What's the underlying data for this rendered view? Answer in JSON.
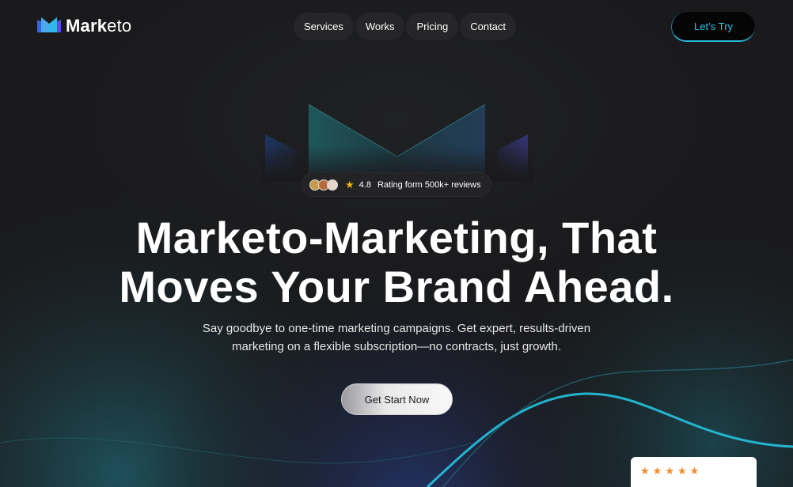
{
  "brand": {
    "name_bold": "Mark",
    "name_light": "eto",
    "logo_icon": "m-logo-icon"
  },
  "nav": {
    "items": [
      "Services",
      "Works",
      "Pricing",
      "Contact"
    ]
  },
  "header_cta": "Let’s Try",
  "rating": {
    "value": "4.8",
    "text": "Rating form 500k+ reviews"
  },
  "hero": {
    "line1": "Marketo-Marketing, That",
    "line2": "Moves Your Brand Ahead.",
    "sub1": "Say goodbye to one-time marketing campaigns. Get expert, results-driven",
    "sub2": "marketing on a flexible subscription—no contracts, just growth."
  },
  "main_cta": "Get Start Now",
  "review_card": {
    "stars": 5
  },
  "colors": {
    "accent": "#2ec5e8",
    "background": "#1a1a1c",
    "star": "#f5b400",
    "review_star": "#f08a28"
  }
}
